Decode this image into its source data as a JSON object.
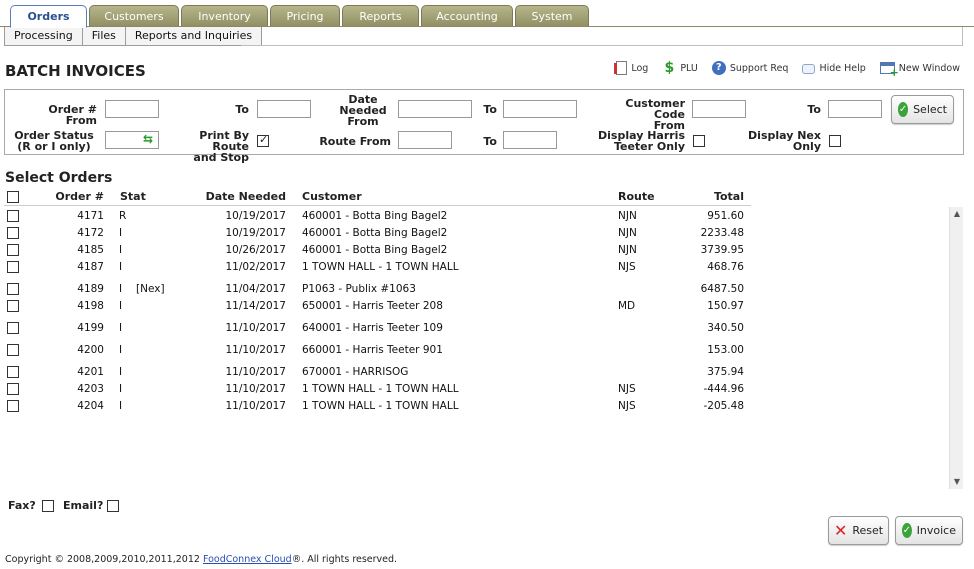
{
  "tabs": [
    "Orders",
    "Customers",
    "Inventory",
    "Pricing",
    "Reports",
    "Accounting",
    "System"
  ],
  "subtabs": [
    "Processing",
    "Files",
    "Reports and Inquiries"
  ],
  "page_title": "BATCH INVOICES",
  "toolbar": {
    "log": "Log",
    "plu": "PLU",
    "support": "Support Req",
    "hide_help": "Hide Help",
    "new_window": "New Window"
  },
  "filters": {
    "order_from": "Order # From",
    "to": "To",
    "to2": "To",
    "date_needed_from_l1": "Date",
    "date_needed_from_l2": "Needed",
    "date_needed_from_l3": "From",
    "customer_code_from_l1": "Customer Code",
    "customer_code_from_l2": "From",
    "to3": "To",
    "order_status_l1": "Order Status",
    "order_status_l2": "(R or I only)",
    "print_by_route_l1": "Print By Route",
    "print_by_route_l2": "and Stop",
    "route_from": "Route From",
    "to4": "To",
    "harris_l1": "Display Harris",
    "harris_l2": "Teeter Only",
    "nex_l1": "Display Nex",
    "nex_l2": "Only",
    "select_button": "Select"
  },
  "section_title": "Select Orders",
  "columns": {
    "order": "Order #",
    "stat": "Stat",
    "date": "Date Needed",
    "customer": "Customer",
    "route": "Route",
    "total": "Total"
  },
  "orders": [
    {
      "order": "4171",
      "stat": "R",
      "flag": "",
      "date": "10/19/2017",
      "customer": "460001 - Botta Bing Bagel2",
      "route": "NJN",
      "total": "951.60"
    },
    {
      "order": "4172",
      "stat": "I",
      "flag": "",
      "date": "10/19/2017",
      "customer": "460001 - Botta Bing Bagel2",
      "route": "NJN",
      "total": "2233.48"
    },
    {
      "order": "4185",
      "stat": "I",
      "flag": "",
      "date": "10/26/2017",
      "customer": "460001 - Botta Bing Bagel2",
      "route": "NJN",
      "total": "3739.95"
    },
    {
      "order": "4187",
      "stat": "I",
      "flag": "",
      "date": "11/02/2017",
      "customer": "1 TOWN HALL - 1 TOWN HALL",
      "route": "NJS",
      "total": "468.76"
    },
    {
      "order": "4189",
      "stat": "I",
      "flag": "[Nex]",
      "date": "11/04/2017",
      "customer": "P1063 - Publix #1063",
      "route": "",
      "total": "6487.50"
    },
    {
      "order": "4198",
      "stat": "I",
      "flag": "",
      "date": "11/14/2017",
      "customer": "650001 - Harris Teeter 208",
      "route": "MD",
      "total": "150.97"
    },
    {
      "order": "4199",
      "stat": "I",
      "flag": "",
      "date": "11/10/2017",
      "customer": "640001 - Harris Teeter 109",
      "route": "",
      "total": "340.50"
    },
    {
      "order": "4200",
      "stat": "I",
      "flag": "",
      "date": "11/10/2017",
      "customer": "660001 - Harris Teeter 901",
      "route": "",
      "total": "153.00"
    },
    {
      "order": "4201",
      "stat": "I",
      "flag": "",
      "date": "11/10/2017",
      "customer": "670001 - HARRISOG",
      "route": "",
      "total": "375.94"
    },
    {
      "order": "4203",
      "stat": "I",
      "flag": "",
      "date": "11/10/2017",
      "customer": "1 TOWN HALL - 1 TOWN HALL",
      "route": "NJS",
      "total": "-444.96"
    },
    {
      "order": "4204",
      "stat": "I",
      "flag": "",
      "date": "11/10/2017",
      "customer": "1 TOWN HALL - 1 TOWN HALL",
      "route": "NJS",
      "total": "-205.48"
    }
  ],
  "bottom": {
    "fax": "Fax?",
    "email": "Email?",
    "reset": "Reset",
    "invoice": "Invoice"
  },
  "footer": {
    "prefix": "Copyright © 2008,2009,2010,2011,2012 ",
    "link": "FoodConnex Cloud",
    "suffix": "®. All rights reserved."
  }
}
